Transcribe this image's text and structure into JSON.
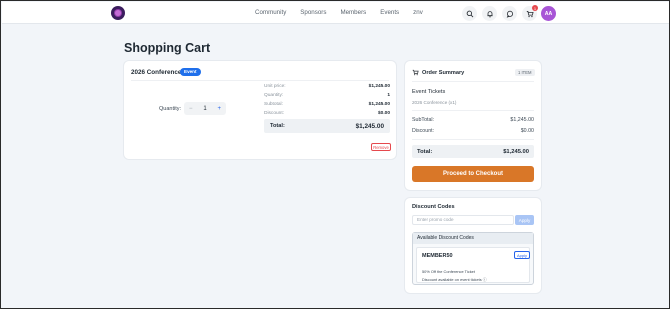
{
  "nav": {
    "links": [
      "Community",
      "Sponsors",
      "Members",
      "Events",
      "znv"
    ],
    "cart_badge": "1",
    "avatar_initials": "AA"
  },
  "page": {
    "title": "Shopping Cart"
  },
  "cart_item": {
    "name": "2026 Conference",
    "tag": "Event",
    "quantity_label": "Quantity:",
    "quantity": "1",
    "minus": "−",
    "plus": "+",
    "details": [
      {
        "label": "Unit price:",
        "value": "$1,245.00"
      },
      {
        "label": "Quantity:",
        "value": "1"
      },
      {
        "label": "Subtotal:",
        "value": "$1,245.00"
      },
      {
        "label": "Discount:",
        "value": "$0.00"
      }
    ],
    "total_label": "Total:",
    "total_value": "$1,245.00",
    "remove_label": "Remove"
  },
  "summary": {
    "title": "Order Summary",
    "items_badge": "1 ITEM",
    "section": "Event Tickets",
    "line_item": "2026 Conference (x1)",
    "subtotal_label": "SubTotal:",
    "subtotal_value": "$1,245.00",
    "discount_label": "Discount:",
    "discount_value": "$0.00",
    "total_label": "Total:",
    "total_value": "$1,245.00",
    "checkout_label": "Proceed to Checkout"
  },
  "discounts": {
    "title": "Discount Codes",
    "placeholder": "Enter promo code",
    "apply_label": "Apply",
    "available_title": "Available Discount Codes",
    "code": "MEMBER50",
    "code_apply": "Apply",
    "description": "50% Off the Conference Ticket",
    "note": "Discount available on event tickets",
    "info_icon": "ⓘ"
  },
  "colors": {
    "accent": "#2563eb",
    "checkout": "#d97728",
    "danger": "#e5484d",
    "avatar": "#a855d6"
  }
}
